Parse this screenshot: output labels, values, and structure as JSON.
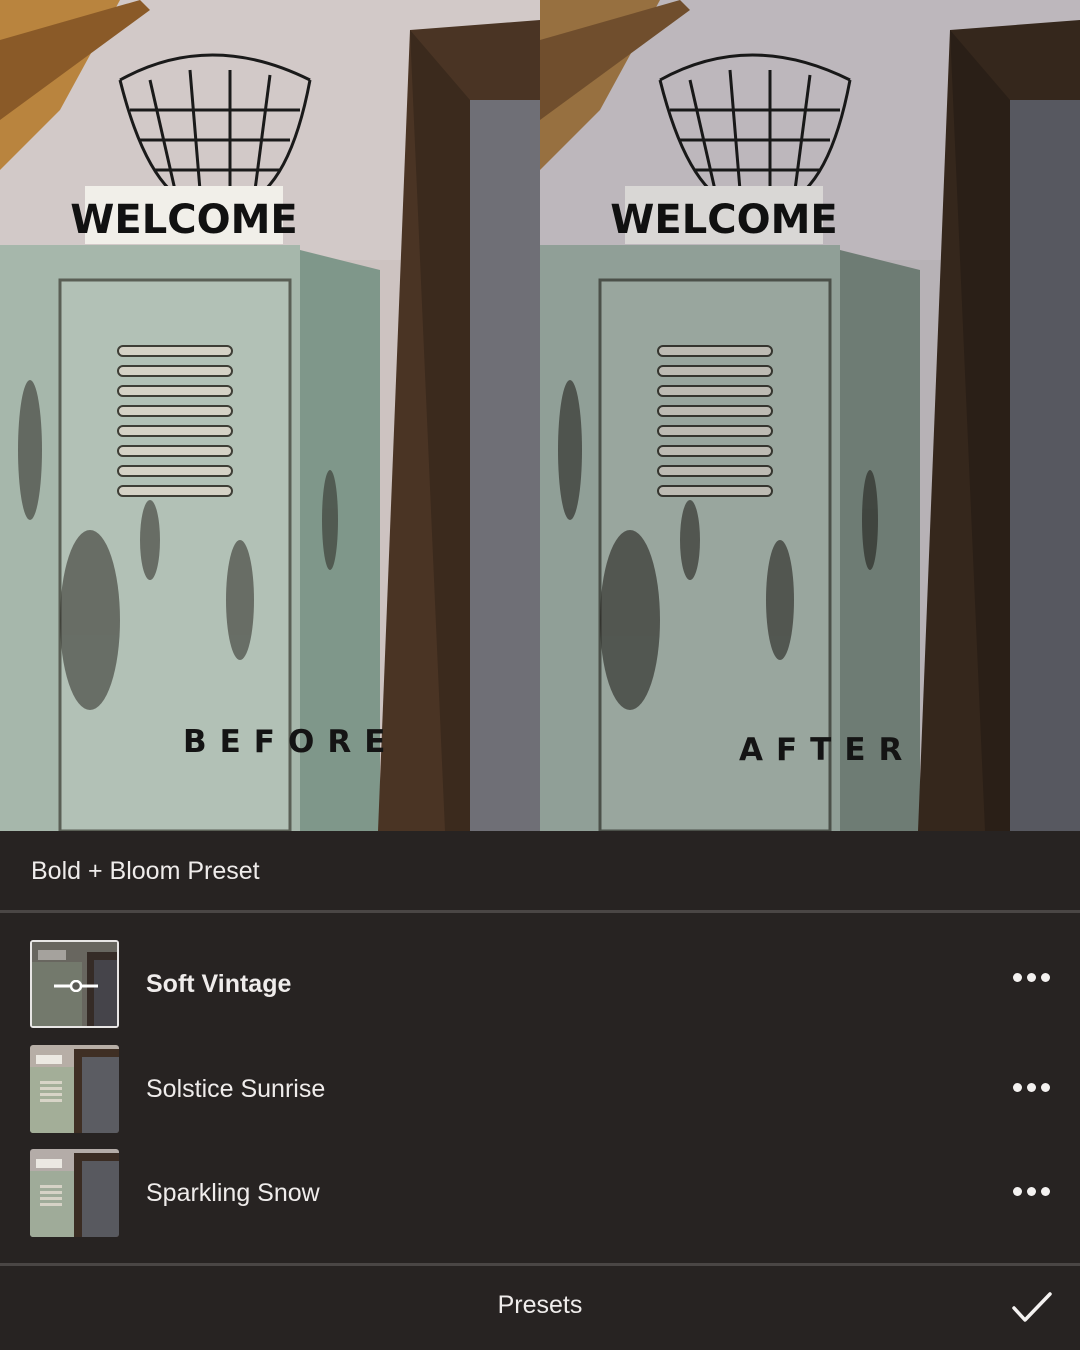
{
  "comparison": {
    "before_label": "BEFORE",
    "after_label": "AFTER",
    "sign_text": "WELCOME"
  },
  "panel": {
    "title": "Bold + Bloom Preset"
  },
  "presets": [
    {
      "label": "Soft Vintage",
      "selected": true
    },
    {
      "label": "Solstice Sunrise",
      "selected": false
    },
    {
      "label": "Sparkling Snow",
      "selected": false
    }
  ],
  "bottom_bar": {
    "label": "Presets"
  },
  "colors": {
    "panel_bg": "#272322",
    "divider": "#4a4645",
    "text": "#efeceb",
    "locker_green": "#9fb2a5",
    "wood_brown": "#4a3424",
    "wall": "#cfc5c3"
  }
}
